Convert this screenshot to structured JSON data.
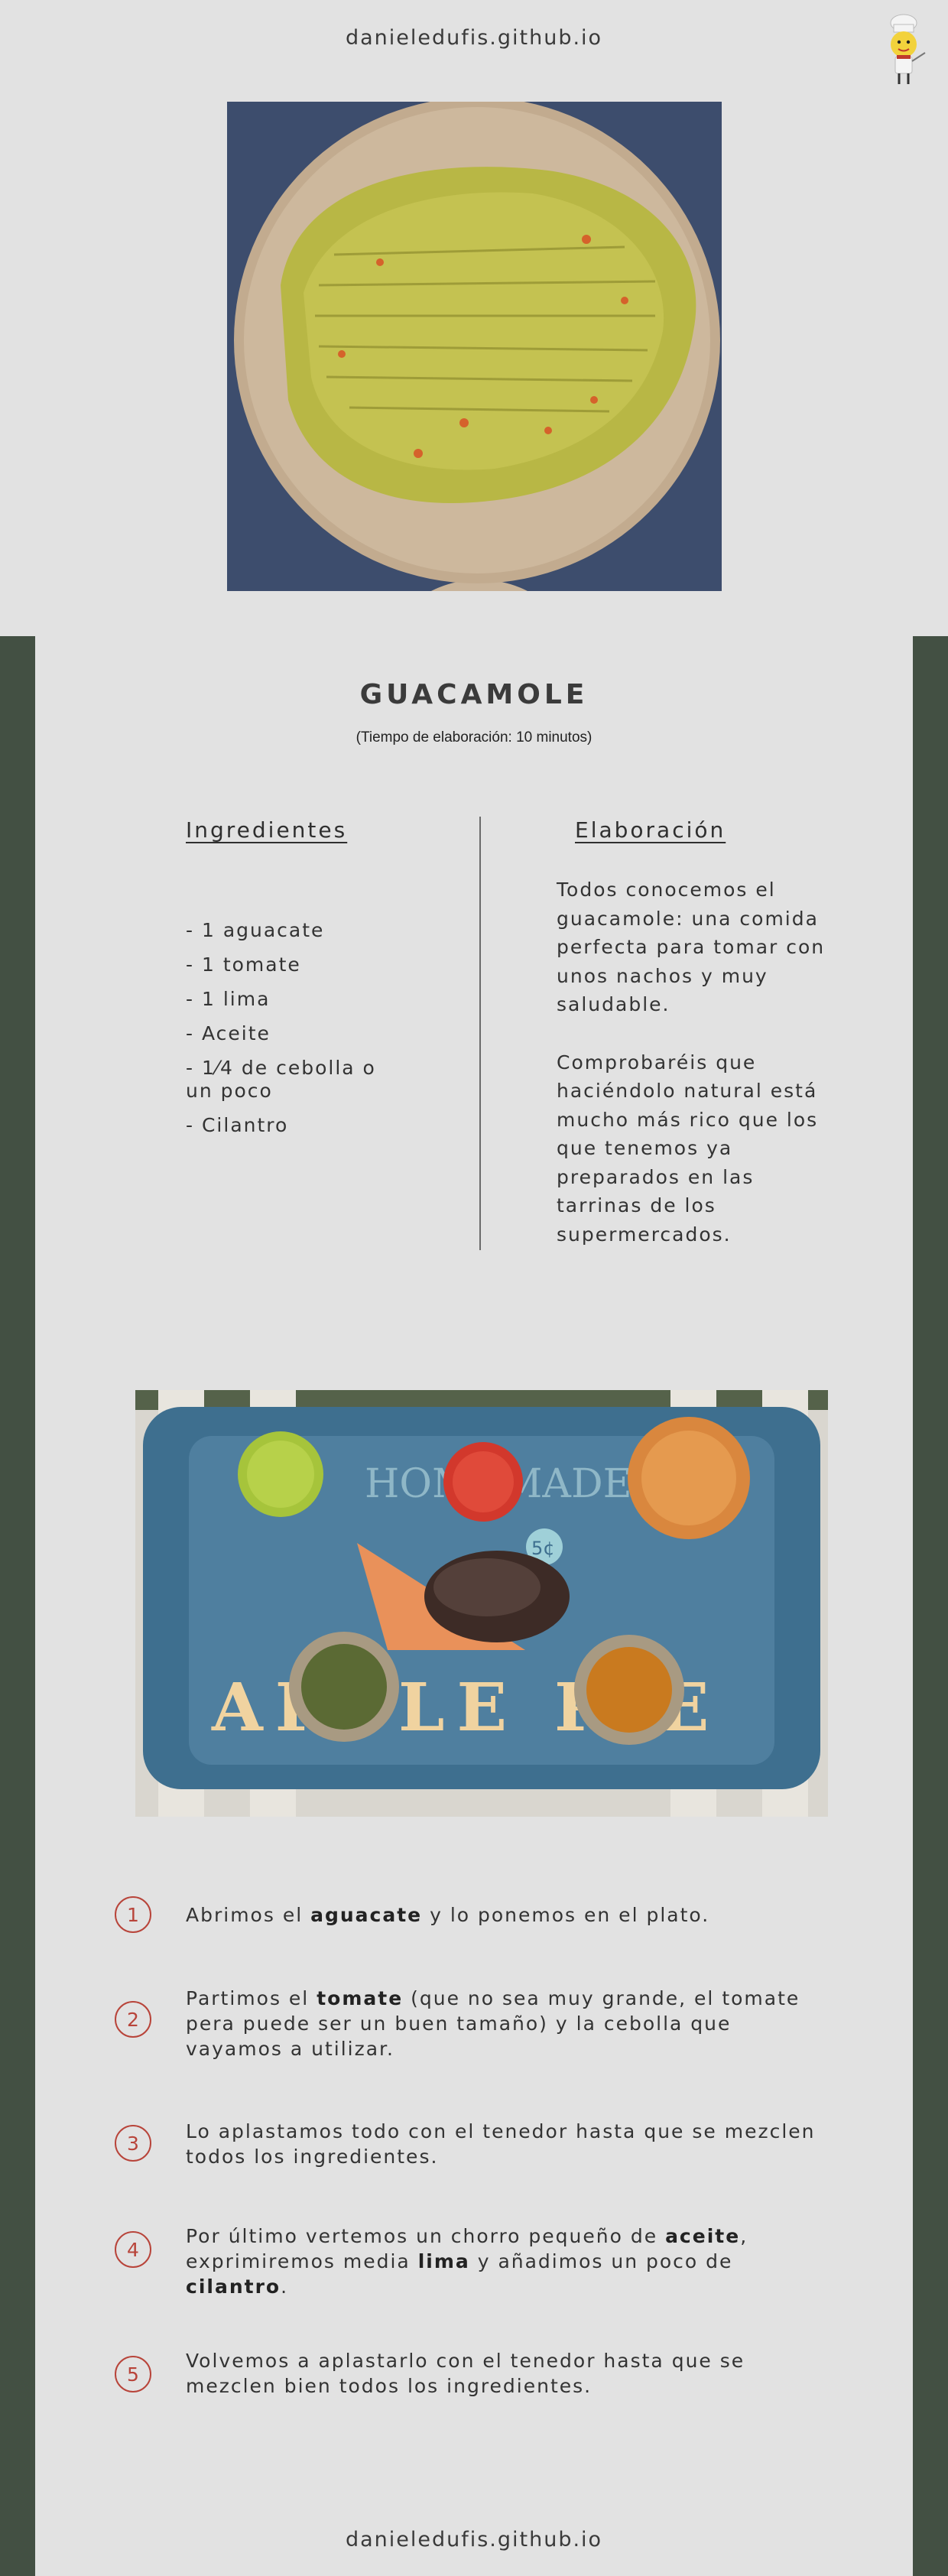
{
  "site": {
    "domain": "danieledufis.github.io"
  },
  "logo": {
    "icon": "chef-icon"
  },
  "recipe": {
    "title": "GUACAMOLE",
    "time": "(Tiempo de elaboración: 10 minutos)"
  },
  "ingredients": {
    "heading": "Ingredientes",
    "items": [
      "- 1 aguacate",
      "- 1 tomate",
      "- 1 lima",
      "- Aceite",
      "- 1⁄4 de cebolla o un poco",
      "- Cilantro"
    ]
  },
  "elaboration": {
    "heading": "Elaboración",
    "paragraphs": [
      "Todos conocemos el guacamole: una comida perfecta para tomar con unos nachos y muy saludable.",
      "Comprobaréis que haciéndolo natural está mucho más rico que los que tenemos ya preparados en las tarrinas de los supermercados."
    ]
  },
  "photo": {
    "tray_text_top": "HOMEMADE",
    "tray_text_bottom": "APPLE PIE",
    "tray_badge": "5¢"
  },
  "steps": [
    {
      "num": "1",
      "parts": [
        "Abrimos el ",
        "aguacate",
        " y lo ponemos en el plato."
      ]
    },
    {
      "num": "2",
      "parts": [
        "Partimos el ",
        "tomate",
        " (que no sea muy grande, el tomate pera puede ser un buen tamaño) y la cebolla que vayamos a utilizar."
      ]
    },
    {
      "num": "3",
      "parts": [
        "Lo aplastamos todo con el tenedor hasta que se mezclen todos los ingredientes."
      ]
    },
    {
      "num": "4",
      "parts": [
        "Por último vertemos un chorro pequeño de ",
        "aceite",
        ", exprimiremos media ",
        "lima",
        " y añadimos un poco de ",
        "cilantro",
        "."
      ]
    },
    {
      "num": "5",
      "parts": [
        "Volvemos a aplastarlo con el tenedor hasta que se mezclen bien todos los ingredientes."
      ]
    }
  ],
  "colors": {
    "band": "#435043",
    "background": "#e2e2e2",
    "step_accent": "#b8443a"
  }
}
